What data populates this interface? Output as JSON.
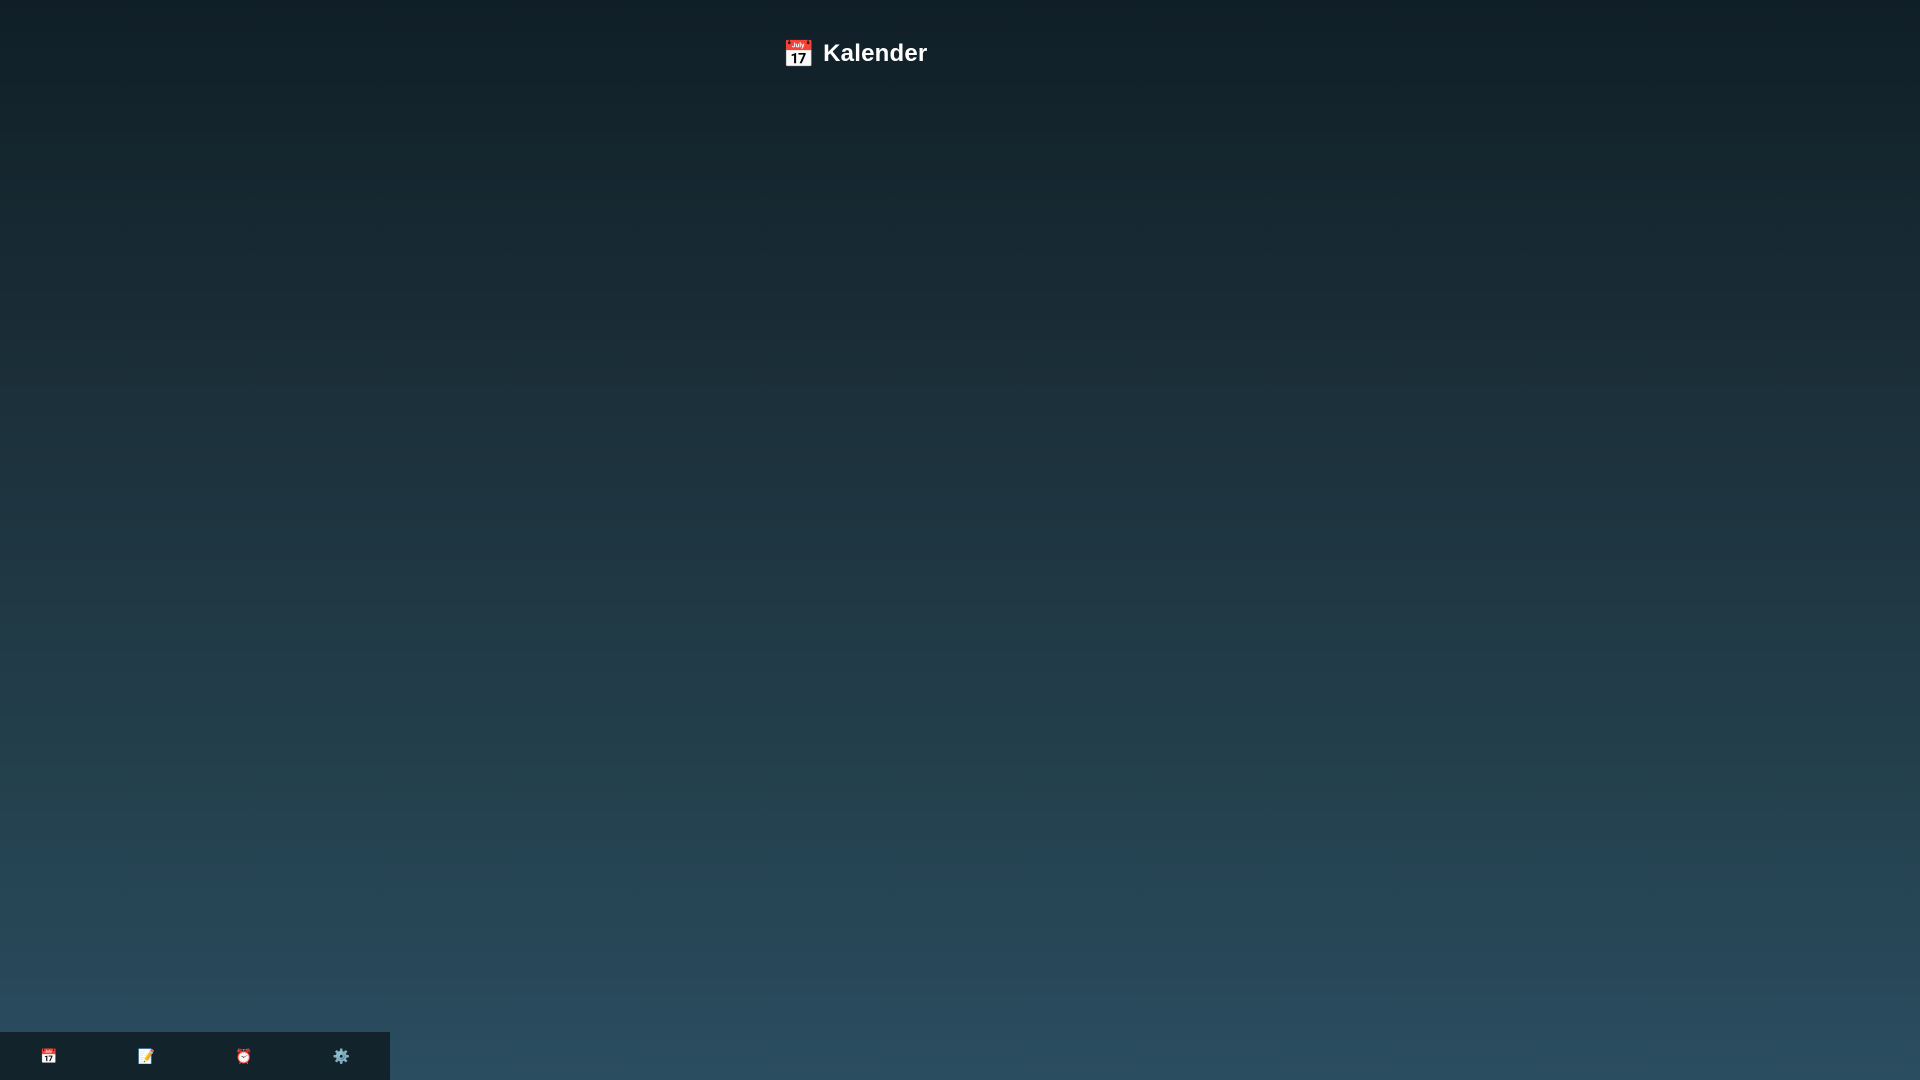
{
  "header": {
    "icon": "📅",
    "icon_name": "calendar-icon",
    "title": "Kalender"
  },
  "bottom_nav": {
    "items": [
      {
        "icon": "📅",
        "icon_name": "calendar-icon"
      },
      {
        "icon": "📝",
        "icon_name": "memo-icon"
      },
      {
        "icon": "⏰",
        "icon_name": "alarm-clock-icon"
      },
      {
        "icon": "⚙️",
        "icon_name": "gear-icon"
      }
    ],
    "background": "#13232c"
  },
  "colors": {
    "background_top": "#101f27",
    "background_bottom": "#2a4d60",
    "text": "#ffffff"
  }
}
